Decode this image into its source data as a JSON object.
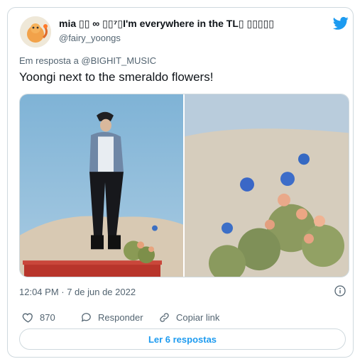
{
  "tweet": {
    "author_name": "mia ▯▯ ∞ ▯▯⁷▯I'm everywhere in the TL▯ ▯▯▯▯▯",
    "author_handle": "@fairy_yoongs",
    "replying_to": "Em resposta a @BIGHIT_MUSIC",
    "text": "Yoongi next to the smeraldo flowers!",
    "timestamp": "12:04 PM · 7 de jun de 2022"
  },
  "actions": {
    "like_count": "870",
    "reply_label": "Responder",
    "copy_link_label": "Copiar link",
    "read_replies_label": "Ler 6 respostas"
  },
  "colors": {
    "accent": "#1d9bf0",
    "secondary_text": "#536471",
    "border": "#cfd9de"
  },
  "icons": [
    "twitter-bird-icon",
    "info-icon",
    "heart-icon",
    "reply-bubble-icon",
    "link-icon"
  ]
}
